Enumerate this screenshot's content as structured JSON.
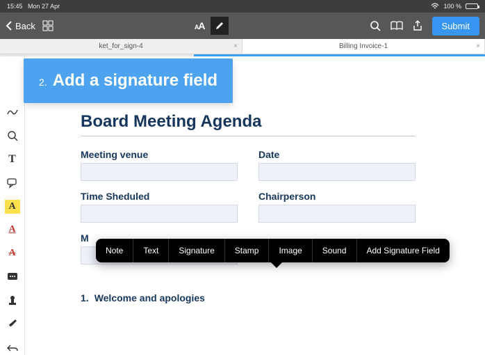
{
  "statusbar": {
    "time": "15:45",
    "date": "Mon 27 Apr",
    "battery": "100 %"
  },
  "toolbar": {
    "back": "Back",
    "submit": "Submit"
  },
  "tabs": [
    {
      "label": "ket_for_sign-4"
    },
    {
      "label": "Billing Invoice-1"
    }
  ],
  "hint": {
    "step": "2.",
    "text": "Add a signature field"
  },
  "document": {
    "title": "Board Meeting Agenda",
    "fields": [
      {
        "label": "Meeting venue"
      },
      {
        "label": "Date"
      },
      {
        "label": "Time Sheduled"
      },
      {
        "label": "Chairperson"
      },
      {
        "label": "M"
      }
    ],
    "agenda": [
      {
        "index": "1.",
        "text": "Welcome and apologies"
      }
    ]
  },
  "popover": [
    "Note",
    "Text",
    "Signature",
    "Stamp",
    "Image",
    "Sound",
    "Add Signature Field"
  ]
}
